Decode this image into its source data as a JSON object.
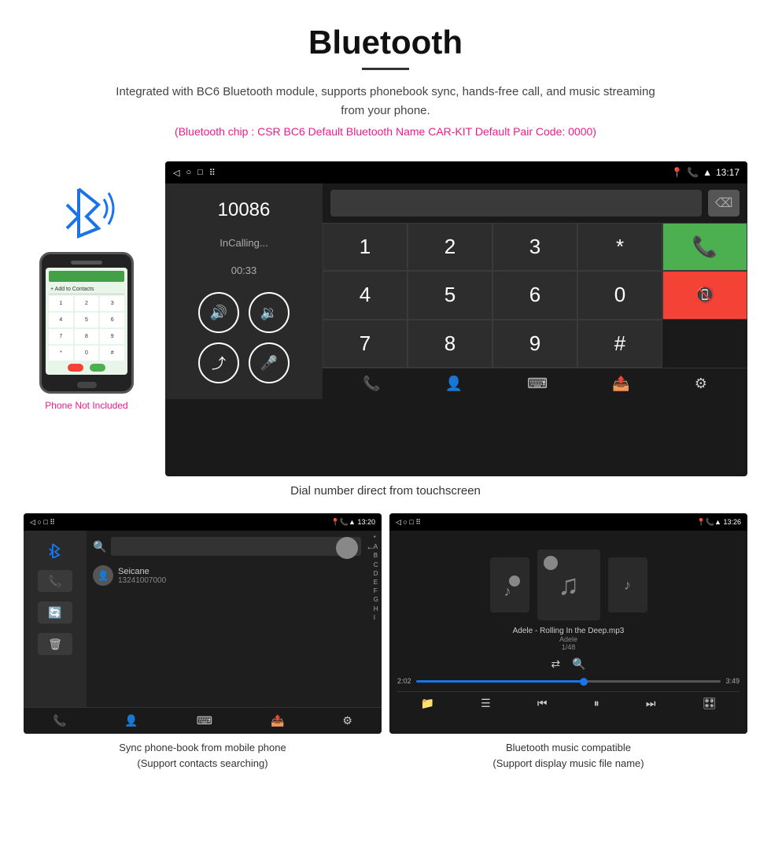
{
  "header": {
    "title": "Bluetooth",
    "description": "Integrated with BC6 Bluetooth module, supports phonebook sync, hands-free call, and music streaming from your phone.",
    "specs": "(Bluetooth chip : CSR BC6    Default Bluetooth Name CAR-KIT    Default Pair Code: 0000)"
  },
  "phone_sidebar": {
    "not_included": "Phone Not Included"
  },
  "main_screen": {
    "statusbar_time": "13:17",
    "call_number": "10086",
    "call_status": "InCalling...",
    "call_timer": "00:33",
    "numpad": [
      "1",
      "2",
      "3",
      "*",
      "4",
      "5",
      "6",
      "0",
      "7",
      "8",
      "9",
      "#"
    ]
  },
  "main_caption": "Dial number direct from touchscreen",
  "bottom_left": {
    "statusbar_time": "13:20",
    "contact_name": "Seicane",
    "contact_number": "13241007000",
    "alpha_list": [
      "*",
      "A",
      "B",
      "C",
      "D",
      "E",
      "F",
      "G",
      "H",
      "I"
    ],
    "caption_line1": "Sync phone-book from mobile phone",
    "caption_line2": "(Support contacts searching)"
  },
  "bottom_right": {
    "statusbar_time": "13:26",
    "track_name": "Adele - Rolling In the Deep.mp3",
    "artist": "Adele",
    "track_count": "1/48",
    "time_current": "2:02",
    "time_total": "3:49",
    "caption_line1": "Bluetooth music compatible",
    "caption_line2": "(Support display music file name)"
  }
}
